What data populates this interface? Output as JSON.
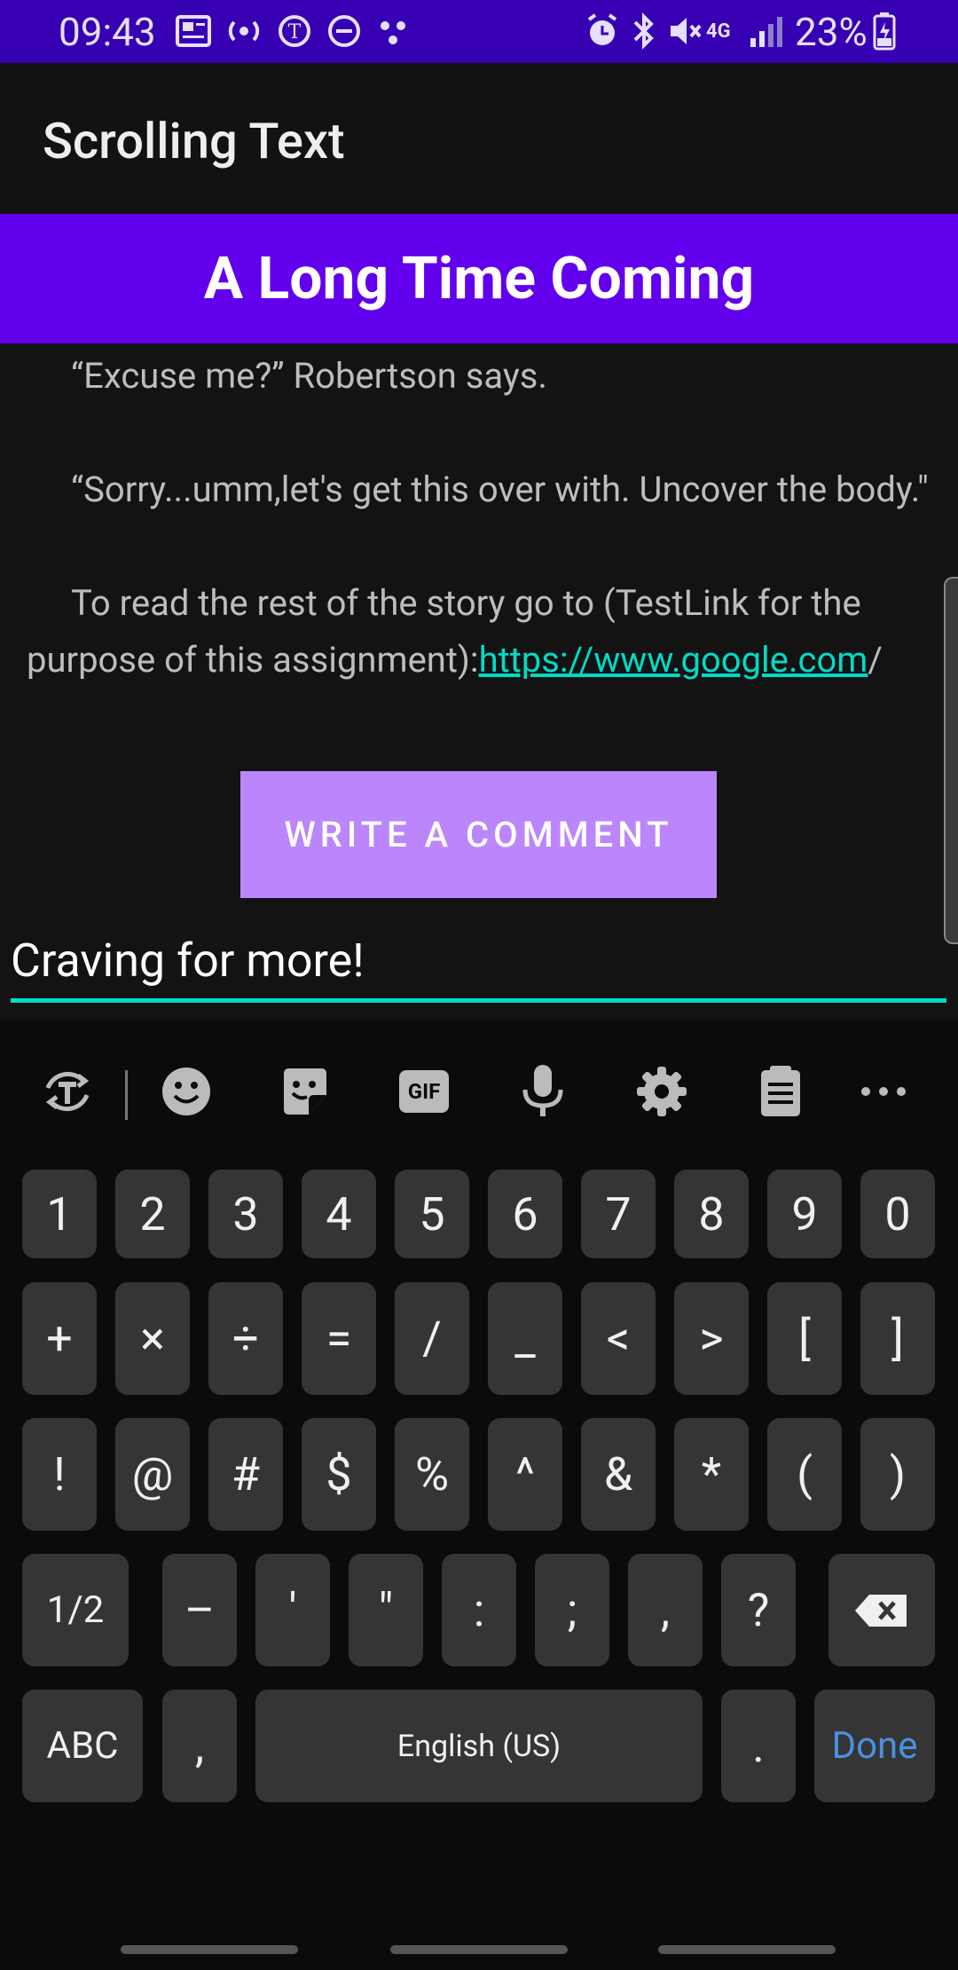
{
  "status_bar": {
    "time": "09:43",
    "battery_percent": "23%",
    "icons": [
      "news-icon",
      "hotspot-icon",
      "nytimes-icon",
      "dnd-icon",
      "dots-icon",
      "alarm-icon",
      "bluetooth-icon",
      "mute-icon",
      "4g-icon",
      "signal-icon",
      "battery-icon"
    ]
  },
  "app_bar": {
    "title": "Scrolling Text"
  },
  "story": {
    "title": "A Long Time Coming",
    "paragraphs": {
      "p1": "“Excuse me?” Robertson says.",
      "p2": "“Sorry...umm,let's get this over with. Uncover the body.\"",
      "p3_prefix": "To read the rest of the story go to (TestLink for the purpose of this assignment):",
      "p3_link": "https://www.google.com",
      "p3_suffix": "/"
    },
    "link_color": "#03dac5"
  },
  "comment_button": {
    "label": "WRITE A COMMENT"
  },
  "comment_input": {
    "value": "Craving for more!"
  },
  "keyboard": {
    "toolbar": [
      "translate-icon",
      "emoji-icon",
      "sticker-icon",
      "gif-icon",
      "mic-icon",
      "settings-icon",
      "clipboard-icon",
      "more-icon"
    ],
    "gif_label": "GIF",
    "row1": [
      "1",
      "2",
      "3",
      "4",
      "5",
      "6",
      "7",
      "8",
      "9",
      "0"
    ],
    "row2": [
      "+",
      "×",
      "÷",
      "=",
      "/",
      "_",
      "<",
      ">",
      "[",
      "]"
    ],
    "row3": [
      "!",
      "@",
      "#",
      "$",
      "%",
      "^",
      "&",
      "*",
      "(",
      ")"
    ],
    "row4": [
      "1/2",
      "–",
      "'",
      "\"",
      ":",
      ";",
      ",",
      "?"
    ],
    "row5": {
      "abc": "ABC",
      "comma": ",",
      "space": "English (US)",
      "period": ".",
      "done": "Done"
    }
  },
  "colors": {
    "status_bar": "#3700b3",
    "header": "#6200ee",
    "button": "#bb86fc",
    "accent": "#03dac5"
  }
}
